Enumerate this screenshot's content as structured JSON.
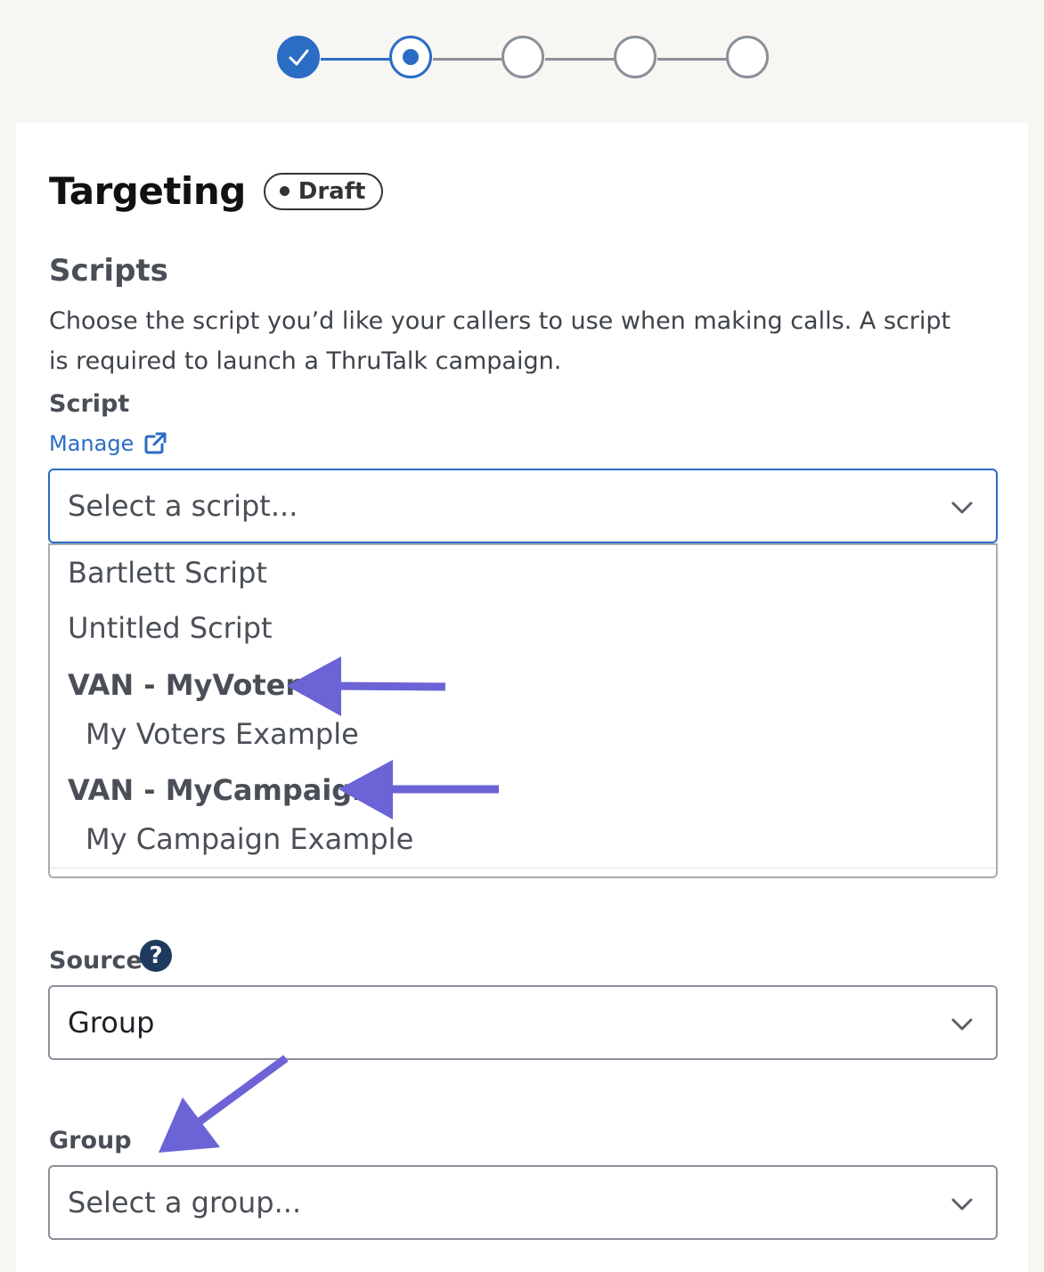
{
  "stepper": {
    "steps": [
      {
        "state": "completed"
      },
      {
        "state": "current"
      },
      {
        "state": "upcoming"
      },
      {
        "state": "upcoming"
      },
      {
        "state": "upcoming"
      }
    ]
  },
  "page": {
    "title": "Targeting",
    "badge": "Draft"
  },
  "scripts": {
    "heading": "Scripts",
    "description": "Choose the script you’d like your callers to use when making calls. A script is required to launch a ThruTalk campaign.",
    "field_label": "Script",
    "manage_link": "Manage",
    "placeholder": "Select a script...",
    "options": [
      {
        "type": "option",
        "label": "Bartlett Script"
      },
      {
        "type": "option",
        "label": "Untitled Script"
      },
      {
        "type": "group",
        "label": "VAN - MyVoters"
      },
      {
        "type": "suboption",
        "label": "My Voters Example"
      },
      {
        "type": "group",
        "label": "VAN - MyCampaign"
      },
      {
        "type": "suboption",
        "label": "My Campaign Example"
      }
    ]
  },
  "source": {
    "label": "Source",
    "help_icon": "?",
    "value": "Group"
  },
  "group": {
    "label": "Group",
    "placeholder": "Select a group..."
  },
  "colors": {
    "accent": "#2b6cc4",
    "annotation_arrow": "#6b63d6",
    "help_icon": "#1f3a5f"
  }
}
